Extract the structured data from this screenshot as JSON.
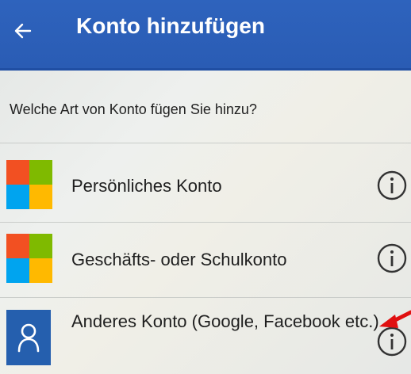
{
  "header": {
    "title": "Konto hinzufügen",
    "back_icon": "back-arrow-icon"
  },
  "question": "Welche Art von Konto fügen Sie hinzu?",
  "accounts": [
    {
      "label": "Persönliches Konto",
      "icon": "microsoft-logo-icon",
      "info_icon": "info-icon"
    },
    {
      "label": "Geschäfts- oder Schulkonto",
      "icon": "microsoft-logo-icon",
      "info_icon": "info-icon"
    },
    {
      "label": "Anderes Konto (Google, Facebook etc.)",
      "icon": "person-icon",
      "info_icon": "info-icon"
    }
  ],
  "colors": {
    "header_blue": "#2a5cb4",
    "tile_blue": "#255fae",
    "annotation_red": "#e01010",
    "ms_red": "#f25022",
    "ms_green": "#7fba00",
    "ms_blue": "#00a4ef",
    "ms_yellow": "#ffb900"
  }
}
